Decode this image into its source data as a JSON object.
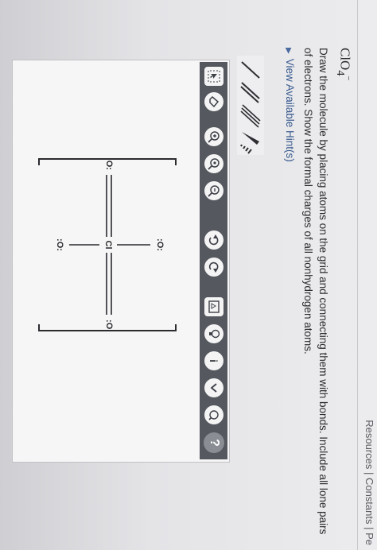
{
  "header": {
    "breadcrumb": "Resources | Constants | Pe"
  },
  "question": {
    "formula_main": "ClO",
    "formula_sub": "4",
    "formula_charge": "−",
    "instruction": "Draw the molecule by placing atoms on the grid and connecting them with bonds. Include all lone pairs of electrons. Show the formal charges of all nonhydrogen atoms.",
    "hint_label": "View Available Hint(s)"
  },
  "toolbar": {
    "icons": [
      "select-icon",
      "eraser-icon",
      "zoom-in-icon",
      "zoom-reset-icon",
      "zoom-out-icon",
      "undo-icon",
      "redo-icon",
      "template-icon",
      "lightbulb-icon",
      "info-icon",
      "expand-icon",
      "help-icon"
    ],
    "info_glyph": "i",
    "help_glyph": "?"
  },
  "bond_tools": [
    "single-bond",
    "double-bond",
    "triple-bond",
    "wedge-bond",
    "hash-bond"
  ],
  "molecule": {
    "center": "Cl",
    "ligands": [
      "O",
      "O",
      "O",
      "O"
    ],
    "lone_pair_glyph": ":O:"
  },
  "colors": {
    "toolbar": "#55595f",
    "hint": "#3a5b8f",
    "canvas": "#f6f6f7"
  }
}
